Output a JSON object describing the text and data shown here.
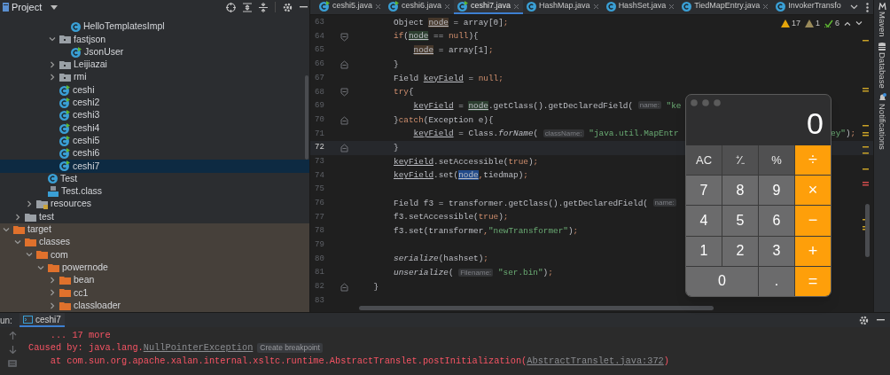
{
  "project_panel": {
    "title": "Project",
    "tree": [
      {
        "children": [
          {
            "children": [
              {
                "children": [
                  {
                    "children": [
                      {
                        "children": [
                          {
                            "label": "HelloTemplatesImpl",
                            "kind": "class",
                            "selected": false
                          }
                        ]
                      },
                      {
                        "label": "fastjson",
                        "kind": "package",
                        "expanded": true,
                        "selected": false,
                        "children": [
                          {
                            "label": "JsonUser",
                            "kind": "runnable-class",
                            "selected": false
                          }
                        ]
                      },
                      {
                        "label": "Leijiazai",
                        "kind": "package",
                        "expanded": false,
                        "selected": false
                      },
                      {
                        "label": "rmi",
                        "kind": "package",
                        "expanded": false,
                        "selected": false
                      },
                      {
                        "label": "ceshi",
                        "kind": "runnable-class",
                        "selected": false
                      },
                      {
                        "label": "ceshi2",
                        "kind": "runnable-class",
                        "selected": false
                      },
                      {
                        "label": "ceshi3",
                        "kind": "runnable-class",
                        "selected": false
                      },
                      {
                        "label": "ceshi4",
                        "kind": "runnable-class",
                        "selected": false
                      },
                      {
                        "label": "ceshi5",
                        "kind": "runnable-class",
                        "selected": false
                      },
                      {
                        "label": "ceshi6",
                        "kind": "runnable-class",
                        "selected": false
                      },
                      {
                        "label": "ceshi7",
                        "kind": "runnable-class",
                        "selected": true
                      }
                    ]
                  },
                  {
                    "label": "Test",
                    "kind": "class",
                    "selected": false
                  },
                  {
                    "label": "Test.class",
                    "kind": "class-file",
                    "selected": false
                  }
                ]
              },
              {
                "label": "resources",
                "kind": "resources-folder",
                "expanded": false,
                "selected": false
              }
            ]
          },
          {
            "label": "test",
            "kind": "folder",
            "expanded": false,
            "selected": false
          }
        ]
      },
      {
        "label": "target",
        "kind": "excluded-folder",
        "expanded": true,
        "selected": false,
        "children": [
          {
            "label": "classes",
            "kind": "excluded-folder",
            "expanded": true,
            "selected": false,
            "children": [
              {
                "label": "com",
                "kind": "excluded-folder",
                "expanded": true,
                "selected": false,
                "children": [
                  {
                    "label": "powernode",
                    "kind": "excluded-folder",
                    "expanded": true,
                    "selected": false,
                    "children": [
                      {
                        "label": "bean",
                        "kind": "excluded-folder",
                        "expanded": false,
                        "selected": false
                      },
                      {
                        "label": "cc1",
                        "kind": "excluded-folder",
                        "expanded": false,
                        "selected": false
                      },
                      {
                        "label": "classloader",
                        "kind": "excluded-folder",
                        "expanded": false,
                        "selected": false
                      }
                    ]
                  }
                ]
              }
            ]
          }
        ]
      }
    ]
  },
  "editor": {
    "tabs": [
      {
        "label": "ceshi5.java",
        "kind": "runnable-class",
        "selected": false,
        "closable": true
      },
      {
        "label": "ceshi6.java",
        "kind": "runnable-class",
        "selected": false,
        "closable": true
      },
      {
        "label": "ceshi7.java",
        "kind": "runnable-class",
        "selected": true,
        "closable": true
      },
      {
        "label": "HashMap.java",
        "kind": "class",
        "selected": false,
        "closable": true
      },
      {
        "label": "HashSet.java",
        "kind": "class",
        "selected": false,
        "closable": true
      },
      {
        "label": "TiedMapEntry.java",
        "kind": "class",
        "selected": false,
        "closable": true
      },
      {
        "label": "InvokerTransfo",
        "kind": "class",
        "selected": false,
        "closable": false
      }
    ],
    "inspections": [
      {
        "kind": "warning",
        "count": "17"
      },
      {
        "kind": "weak-warning",
        "count": "1"
      },
      {
        "kind": "typo",
        "count": "6"
      }
    ],
    "lines": [
      {
        "number": "63",
        "current": false,
        "tokens": [
          {
            "text": "        Object ",
            "kind": "plain"
          },
          {
            "text": "node",
            "kind": "write-usage"
          },
          {
            "text": " = array[0]",
            "kind": "plain"
          },
          {
            "text": ";",
            "kind": "keyword"
          }
        ]
      },
      {
        "number": "64",
        "current": false,
        "fold_start": true,
        "tokens": [
          {
            "text": "        if",
            "kind": "keyword"
          },
          {
            "text": "(",
            "kind": "plain"
          },
          {
            "text": "node",
            "kind": "read-usage"
          },
          {
            "text": " == ",
            "kind": "plain"
          },
          {
            "text": "null",
            "kind": "keyword"
          },
          {
            "text": "){",
            "kind": "plain"
          }
        ]
      },
      {
        "number": "65",
        "current": false,
        "tokens": [
          {
            "text": "            node",
            "kind": "write-usage"
          },
          {
            "text": " = array[1]",
            "kind": "plain"
          },
          {
            "text": ";",
            "kind": "keyword"
          }
        ]
      },
      {
        "number": "66",
        "current": false,
        "fold_end": true,
        "tokens": [
          {
            "text": "        }",
            "kind": "plain"
          }
        ]
      },
      {
        "number": "67",
        "current": false,
        "tokens": [
          {
            "text": "        Field ",
            "kind": "plain"
          },
          {
            "text": "keyField",
            "kind": "underlined"
          },
          {
            "text": " = ",
            "kind": "plain"
          },
          {
            "text": "null;",
            "kind": "keyword"
          }
        ]
      },
      {
        "number": "68",
        "current": false,
        "fold_start": true,
        "tokens": [
          {
            "text": "        try",
            "kind": "keyword"
          },
          {
            "text": "{",
            "kind": "plain"
          }
        ]
      },
      {
        "number": "69",
        "current": false,
        "tokens": [
          {
            "text": "            keyField",
            "kind": "underlined"
          },
          {
            "text": " = ",
            "kind": "plain"
          },
          {
            "text": "node",
            "kind": "read-usage"
          },
          {
            "text": ".getClass().getDeclaredField( ",
            "kind": "plain"
          },
          {
            "text": "name:",
            "kind": "hint"
          },
          {
            "text": " \"ke",
            "kind": "string"
          }
        ]
      },
      {
        "number": "70",
        "current": false,
        "fold_end": true,
        "tokens": [
          {
            "text": "        }",
            "kind": "plain"
          },
          {
            "text": "catch",
            "kind": "keyword"
          },
          {
            "text": "(Exception e){",
            "kind": "plain"
          }
        ]
      },
      {
        "number": "71",
        "current": false,
        "tokens": [
          {
            "text": "            keyField",
            "kind": "underlined"
          },
          {
            "text": " = Class.",
            "kind": "plain"
          },
          {
            "text": "forName",
            "kind": "italic"
          },
          {
            "text": "( ",
            "kind": "plain"
          },
          {
            "text": "className:",
            "kind": "hint"
          },
          {
            "text": " \"java.util.MapEntr",
            "kind": "string"
          }
        ],
        "tail": [
          {
            "text": "ey\"",
            "kind": "string"
          },
          {
            "text": ")",
            "kind": "plain"
          },
          {
            "text": ";",
            "kind": "keyword"
          }
        ]
      },
      {
        "number": "72",
        "current": true,
        "fold_end": true,
        "tokens": [
          {
            "text": "        }",
            "kind": "plain"
          }
        ]
      },
      {
        "number": "73",
        "current": false,
        "tokens": [
          {
            "text": "        keyField",
            "kind": "underlined"
          },
          {
            "text": ".setAccessible(",
            "kind": "plain"
          },
          {
            "text": "true",
            "kind": "keyword"
          },
          {
            "text": ")",
            "kind": "plain"
          },
          {
            "text": ";",
            "kind": "keyword"
          }
        ]
      },
      {
        "number": "74",
        "current": false,
        "tokens": [
          {
            "text": "        keyField",
            "kind": "underlined"
          },
          {
            "text": ".set(",
            "kind": "plain"
          },
          {
            "text": "node",
            "kind": "selection"
          },
          {
            "text": ",",
            "kind": "keyword"
          },
          {
            "text": "tiedmap)",
            "kind": "plain"
          },
          {
            "text": ";",
            "kind": "keyword"
          }
        ]
      },
      {
        "number": "75",
        "current": false
      },
      {
        "number": "76",
        "current": false,
        "tokens": [
          {
            "text": "        Field f3 = transformer.getClass().getDeclaredField( ",
            "kind": "plain"
          },
          {
            "text": "name:",
            "kind": "hint"
          }
        ]
      },
      {
        "number": "77",
        "current": false,
        "tokens": [
          {
            "text": "        f3.setAccessible(",
            "kind": "plain"
          },
          {
            "text": "true",
            "kind": "keyword"
          },
          {
            "text": ")",
            "kind": "plain"
          },
          {
            "text": ";",
            "kind": "keyword"
          }
        ]
      },
      {
        "number": "78",
        "current": false,
        "tokens": [
          {
            "text": "        f3.set(transformer",
            "kind": "plain"
          },
          {
            "text": ",",
            "kind": "keyword"
          },
          {
            "text": "\"newTransformer\"",
            "kind": "string"
          },
          {
            "text": ")",
            "kind": "plain"
          },
          {
            "text": ";",
            "kind": "keyword"
          }
        ]
      },
      {
        "number": "79",
        "current": false
      },
      {
        "number": "80",
        "current": false,
        "tokens": [
          {
            "text": "        serialize",
            "kind": "italic"
          },
          {
            "text": "(hashset)",
            "kind": "plain"
          },
          {
            "text": ";",
            "kind": "keyword"
          }
        ]
      },
      {
        "number": "81",
        "current": false,
        "tokens": [
          {
            "text": "        unserialize",
            "kind": "italic"
          },
          {
            "text": "( ",
            "kind": "plain"
          },
          {
            "text": "Filename:",
            "kind": "hint"
          },
          {
            "text": " \"ser.bin\"",
            "kind": "string"
          },
          {
            "text": ")",
            "kind": "plain"
          },
          {
            "text": ";",
            "kind": "keyword"
          }
        ]
      },
      {
        "number": "82",
        "current": false,
        "fold_end": true,
        "tokens": [
          {
            "text": "    }",
            "kind": "plain"
          }
        ]
      },
      {
        "number": "83",
        "current": false
      }
    ]
  },
  "calculator": {
    "display": "0",
    "keys": [
      {
        "label": "AC",
        "kind": "function"
      },
      {
        "label": "⁺⁄₋",
        "kind": "function"
      },
      {
        "label": "%",
        "kind": "function"
      },
      {
        "label": "÷",
        "kind": "operator"
      },
      {
        "label": "7",
        "kind": "digit"
      },
      {
        "label": "8",
        "kind": "digit"
      },
      {
        "label": "9",
        "kind": "digit"
      },
      {
        "label": "×",
        "kind": "operator"
      },
      {
        "label": "4",
        "kind": "digit"
      },
      {
        "label": "5",
        "kind": "digit"
      },
      {
        "label": "6",
        "kind": "digit"
      },
      {
        "label": "−",
        "kind": "operator"
      },
      {
        "label": "1",
        "kind": "digit"
      },
      {
        "label": "2",
        "kind": "digit"
      },
      {
        "label": "3",
        "kind": "digit"
      },
      {
        "label": "+",
        "kind": "operator"
      },
      {
        "label": "0",
        "kind": "wide-digit"
      },
      {
        "label": ".",
        "kind": "digit"
      },
      {
        "label": "=",
        "kind": "operator"
      }
    ]
  },
  "side_tools": [
    {
      "label": "Maven",
      "kind": "maven"
    },
    {
      "label": "Database",
      "kind": "database"
    },
    {
      "label": "Notifications",
      "kind": "notifications"
    }
  ],
  "run_panel": {
    "label": "un:",
    "tabs": [
      {
        "label": "ceshi7",
        "selected": true
      }
    ],
    "console": [
      [
        {
          "text": "    ... 17 more",
          "kind": "error"
        }
      ],
      [
        {
          "text": "Caused by: java.lang.",
          "kind": "error"
        },
        {
          "text": "NullPointerException",
          "kind": "link"
        },
        {
          "text": "Create breakpoint",
          "kind": "badge"
        }
      ],
      [
        {
          "text": "    at com.sun.org.apache.xalan.internal.xsltc.runtime.AbstractTranslet.postInitialization(",
          "kind": "error"
        },
        {
          "text": "AbstractTranslet.java:372",
          "kind": "link"
        },
        {
          "text": ")",
          "kind": "error"
        }
      ]
    ]
  }
}
